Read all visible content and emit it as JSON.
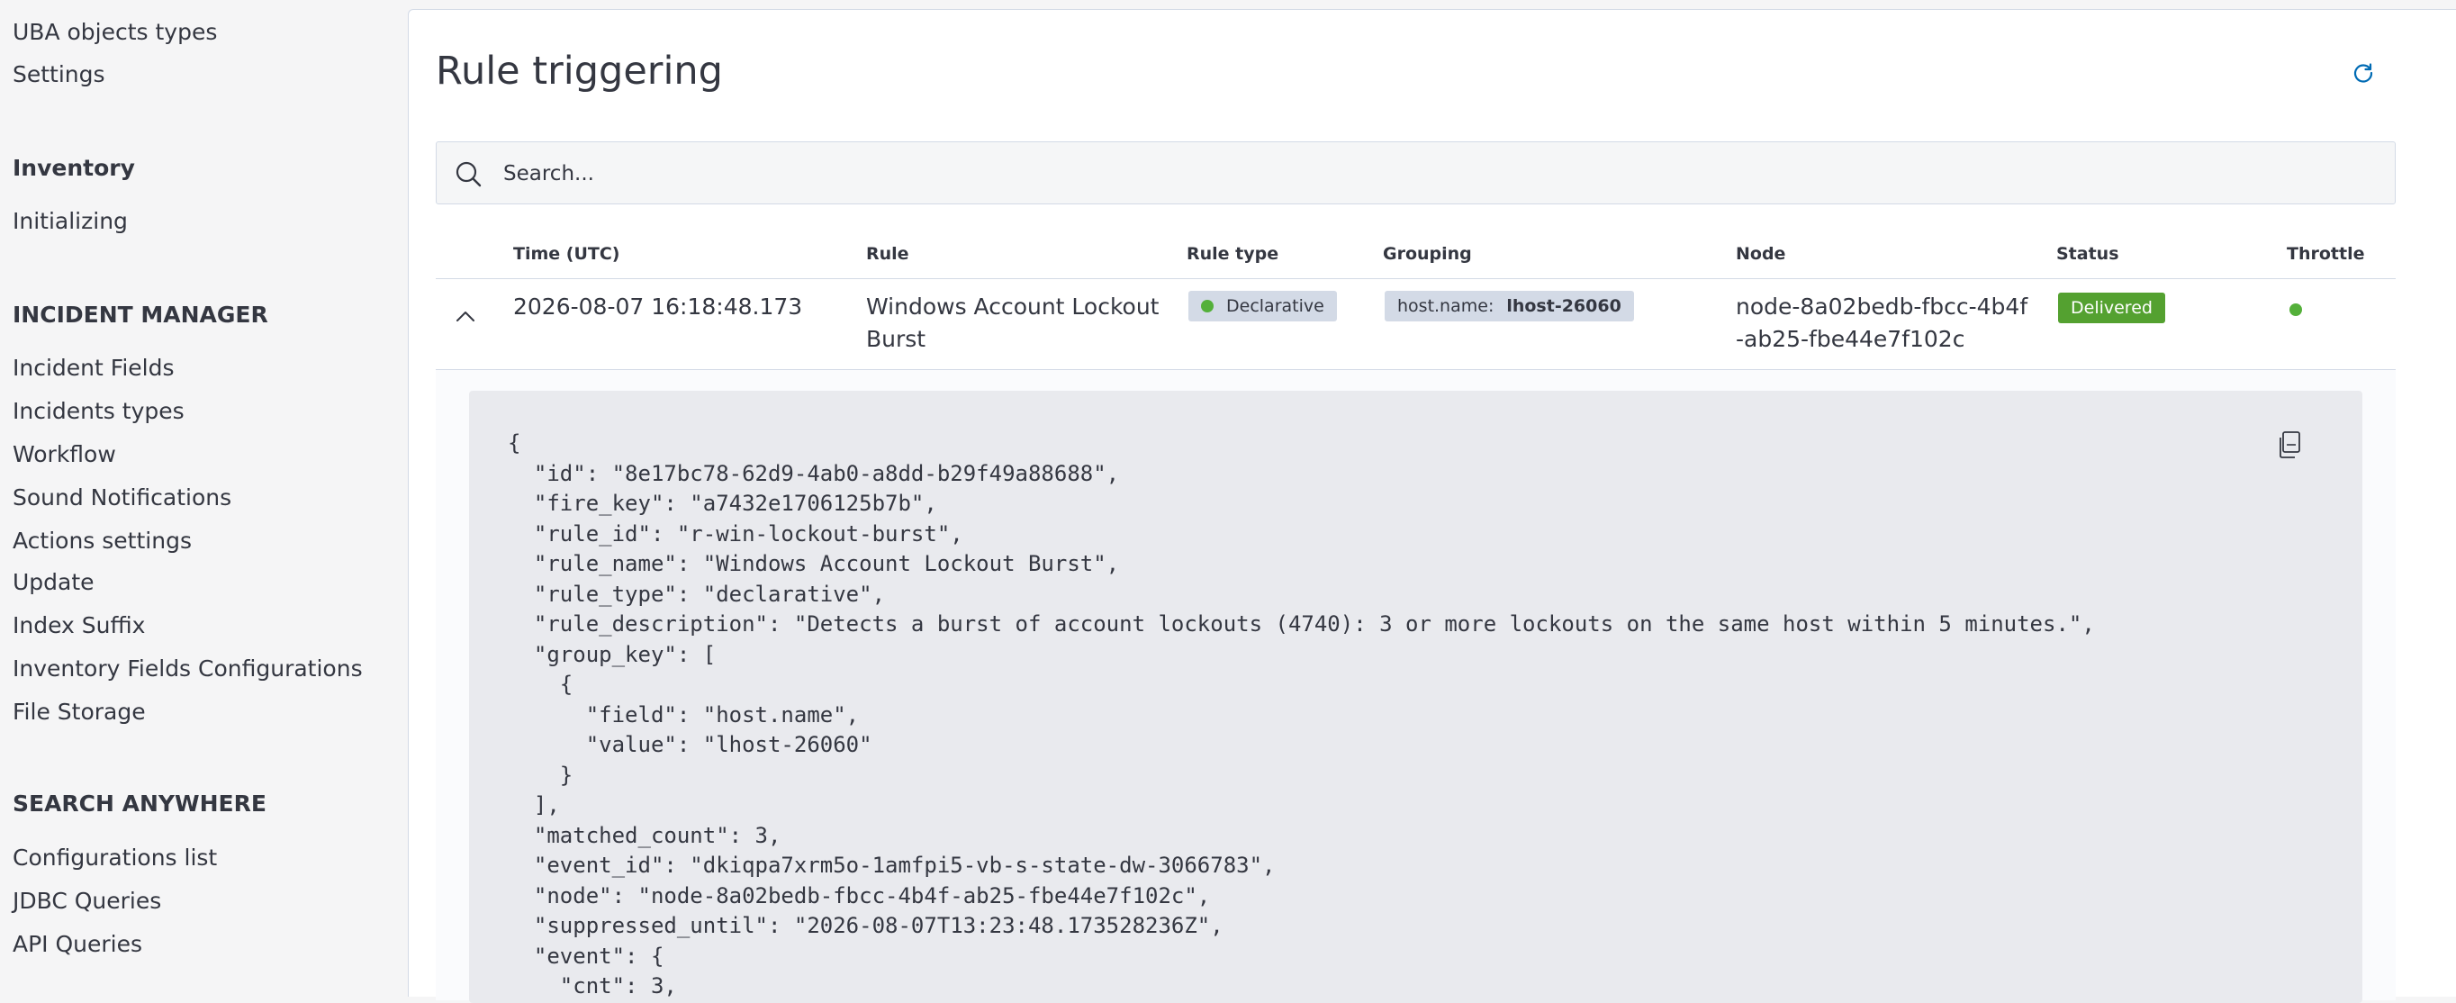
{
  "sidebar": {
    "items_top": [
      {
        "label": "UBA objects types"
      },
      {
        "label": "Settings"
      }
    ],
    "inventory": {
      "heading": "Inventory",
      "items": [
        {
          "label": "Initializing"
        }
      ]
    },
    "incident_manager": {
      "heading": "INCIDENT MANAGER",
      "items": [
        {
          "label": "Incident Fields"
        },
        {
          "label": "Incidents types"
        },
        {
          "label": "Workflow"
        },
        {
          "label": "Sound Notifications"
        },
        {
          "label": "Actions settings"
        },
        {
          "label": "Update"
        },
        {
          "label": "Index Suffix"
        },
        {
          "label": "Inventory Fields Configurations"
        },
        {
          "label": "File Storage"
        }
      ]
    },
    "search_anywhere": {
      "heading": "SEARCH ANYWHERE",
      "items": [
        {
          "label": "Configurations list"
        },
        {
          "label": "JDBC Queries"
        },
        {
          "label": "API Queries"
        }
      ]
    }
  },
  "main": {
    "title": "Rule triggering",
    "refresh_icon": "refresh-icon",
    "search": {
      "placeholder": "Search...",
      "value": ""
    },
    "table": {
      "columns": [
        "Time (UTC)",
        "Rule",
        "Rule type",
        "Grouping",
        "Node",
        "Status",
        "Throttle"
      ],
      "rows": [
        {
          "time": "2026-08-07 16:18:48.173",
          "rule": "Windows Account Lockout Burst",
          "rule_type": "Declarative",
          "grouping_key": "host.name:",
          "grouping_value": "lhost-26060",
          "node": "node-8a02bedb-fbcc-4b4f-ab25-fbe44e7f102c",
          "status": "Delivered",
          "throttle": "active"
        }
      ]
    },
    "json_lines": [
      "{",
      "  \"id\": \"8e17bc78-62d9-4ab0-a8dd-b29f49a88688\",",
      "  \"fire_key\": \"a7432e1706125b7b\",",
      "  \"rule_id\": \"r-win-lockout-burst\",",
      "  \"rule_name\": \"Windows Account Lockout Burst\",",
      "  \"rule_type\": \"declarative\",",
      "  \"rule_description\": \"Detects a burst of account lockouts (4740): 3 or more lockouts on the same host within 5 minutes.\",",
      "  \"group_key\": [",
      "    {",
      "      \"field\": \"host.name\",",
      "      \"value\": \"lhost-26060\"",
      "    }",
      "  ],",
      "  \"matched_count\": 3,",
      "  \"event_id\": \"dkiqpa7xrm5o-1amfpi5-vb-s-state-dw-3066783\",",
      "  \"node\": \"node-8a02bedb-fbcc-4b4f-ab25-fbe44e7f102c\",",
      "  \"suppressed_until\": \"2026-08-07T13:23:48.173528236Z\",",
      "  \"event\": {",
      "    \"cnt\": 3,"
    ]
  },
  "colors": {
    "accent_green": "#54a130",
    "dot_green": "#54b03a",
    "badge_gray": "#d3dae6",
    "text": "#343741",
    "refresh_blue": "#006bb4"
  }
}
